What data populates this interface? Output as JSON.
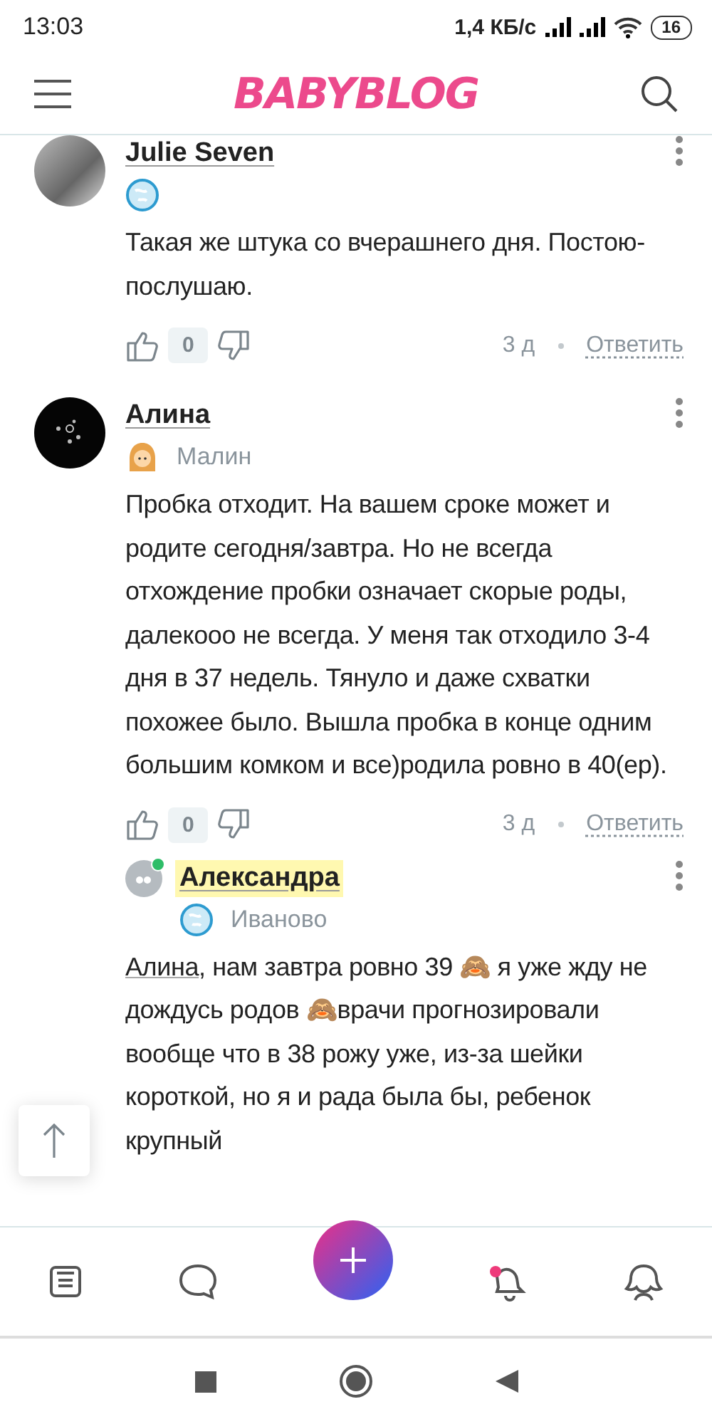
{
  "status_bar": {
    "time": "13:03",
    "speed": "1,4 КБ/с",
    "battery": "16"
  },
  "header": {
    "logo": "BABYBLOG"
  },
  "comments": [
    {
      "author": "Julie Seven",
      "avatar": {
        "kind": "photo"
      },
      "online": false,
      "highlighted": false,
      "badge": {
        "kind": "globe"
      },
      "text": "Такая же штука со вчерашнего дня. Постою-послушаю.",
      "likes": "0",
      "time": "3 д",
      "reply": "Ответить"
    },
    {
      "author": "Алина",
      "avatar": {
        "kind": "dark"
      },
      "online": false,
      "highlighted": false,
      "badge": {
        "kind": "girl"
      },
      "city": "Малин",
      "text": "Пробка отходит. На вашем сроке может и родите сегодня/завтра. Но не всегда отхождение пробки означает скорые роды, далекооо не всегда. У меня так отходило 3-4 дня в 37 недель. Тянуло и даже схватки похожее было. Вышла пробка в конце одним большим комком и все)родила ровно в 40(ер).",
      "likes": "0",
      "time": "3 д",
      "reply": "Ответить",
      "children": [
        {
          "author": "Александра",
          "avatar": {
            "kind": "default"
          },
          "online": true,
          "highlighted": true,
          "badge": {
            "kind": "globe"
          },
          "city": "Иваново",
          "mention": "Алина",
          "text": ", нам завтра ровно 39 🙈 я уже жду не дождусь родов 🙈врачи прогнозировали вообще что в 38 рожу уже, из-за шейки короткой, но я и рада была бы, ребенок крупный"
        }
      ]
    }
  ],
  "bottom_nav": [
    {
      "kind": "feed"
    },
    {
      "kind": "chat"
    },
    {
      "kind": "add"
    },
    {
      "kind": "notifications",
      "unread": true
    },
    {
      "kind": "profile"
    }
  ]
}
